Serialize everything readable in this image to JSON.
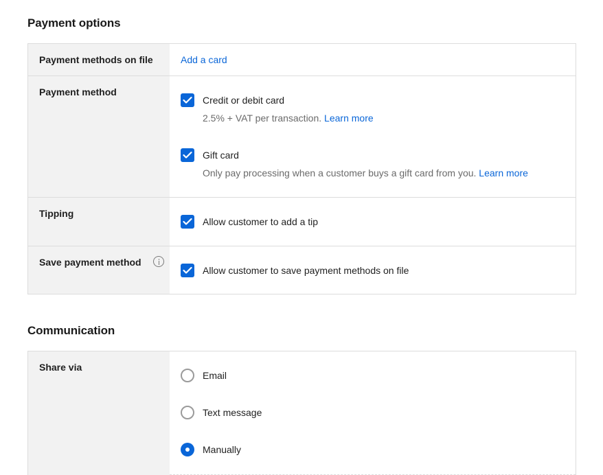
{
  "payment_options": {
    "title": "Payment options",
    "methods_on_file": {
      "label": "Payment methods on file",
      "link": "Add a card"
    },
    "payment_method": {
      "label": "Payment method",
      "options": [
        {
          "label": "Credit or debit card",
          "checked": true,
          "description": "2.5% + VAT per transaction.",
          "link": "Learn more"
        },
        {
          "label": "Gift card",
          "checked": true,
          "description": "Only pay processing when a customer buys a gift card from you.",
          "link": "Learn more"
        }
      ]
    },
    "tipping": {
      "label": "Tipping",
      "option": "Allow customer to add a tip",
      "checked": true
    },
    "save_payment": {
      "label": "Save payment method",
      "info_icon": "info-icon",
      "option": "Allow customer to save payment methods on file",
      "checked": true
    }
  },
  "communication": {
    "title": "Communication",
    "share_via": {
      "label": "Share via",
      "options": [
        {
          "label": "Email",
          "selected": false
        },
        {
          "label": "Text message",
          "selected": false
        },
        {
          "label": "Manually",
          "selected": true
        }
      ]
    }
  },
  "colors": {
    "accent": "#0a66d8",
    "label_bg": "#f2f2f2",
    "border": "#dcdcdc"
  }
}
